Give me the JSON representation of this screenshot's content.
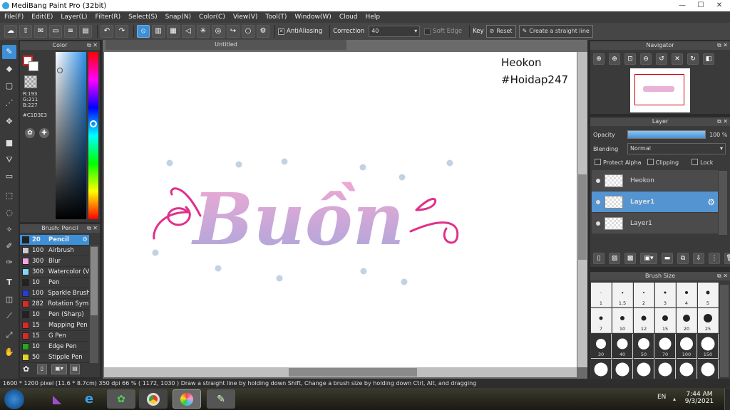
{
  "window": {
    "title": "MediBang Paint Pro (32bit)",
    "minimize": "—",
    "maximize": "☐",
    "close": "✕"
  },
  "menu": [
    "File(F)",
    "Edit(E)",
    "Layer(L)",
    "Filter(R)",
    "Select(S)",
    "Snap(N)",
    "Color(C)",
    "View(V)",
    "Tool(T)",
    "Window(W)",
    "Cloud",
    "Help"
  ],
  "toolbar": {
    "antialiasing": "AntiAliasing",
    "correction_label": "Correction",
    "correction_value": "40",
    "soft_edge": "Soft Edge",
    "key": "Key",
    "reset": "Reset",
    "straight_line": "Create a straight line"
  },
  "color_panel": {
    "title": "Color",
    "r": "R:193",
    "g": "G:211",
    "b": "B:227",
    "hex": "#C1D3E3",
    "accent": "#C1D3E3"
  },
  "canvas": {
    "tab": "Untitled",
    "watermark_line1": "Heokon",
    "watermark_line2": "#Hoidap247",
    "artwork_text": "Buồn"
  },
  "brush_panel": {
    "title": "Brush: Pencil",
    "items": [
      {
        "size": "20",
        "name": "Pencil",
        "color": "#222222"
      },
      {
        "size": "100",
        "name": "Airbrush",
        "color": "#cccccc"
      },
      {
        "size": "300",
        "name": "Blur",
        "color": "#f2a7e6"
      },
      {
        "size": "300",
        "name": "Watercolor (V",
        "color": "#7fd6f5"
      },
      {
        "size": "10",
        "name": "Pen",
        "color": "#222222"
      },
      {
        "size": "100",
        "name": "Sparkle Brush",
        "color": "#2a3bd6"
      },
      {
        "size": "282",
        "name": "Rotation Symi",
        "color": "#d92a2a"
      },
      {
        "size": "10",
        "name": "Pen (Sharp)",
        "color": "#222222"
      },
      {
        "size": "15",
        "name": "Mapping Pen",
        "color": "#d92a2a"
      },
      {
        "size": "15",
        "name": "G Pen",
        "color": "#d92a2a"
      },
      {
        "size": "10",
        "name": "Edge Pen",
        "color": "#22aa22"
      },
      {
        "size": "50",
        "name": "Stipple Pen",
        "color": "#e6d22a"
      }
    ]
  },
  "navigator": {
    "title": "Navigator"
  },
  "layer_panel": {
    "title": "Layer",
    "opacity_label": "Opacity",
    "opacity_value": "100 %",
    "opacity_fraction": 1.0,
    "blending_label": "Blending",
    "blending_value": "Normal",
    "protect_alpha": "Protect Alpha",
    "clipping": "Clipping",
    "lock": "Lock",
    "layers": [
      {
        "name": "Heokon",
        "selected": false
      },
      {
        "name": "Layer1",
        "selected": true
      },
      {
        "name": "Layer1",
        "selected": false
      }
    ]
  },
  "brush_size": {
    "title": "Brush Size",
    "sizes": [
      "1",
      "1.5",
      "2",
      "3",
      "4",
      "5",
      "7",
      "10",
      "12",
      "15",
      "20",
      "25",
      "30",
      "40",
      "50",
      "70",
      "100",
      "150",
      "",
      "",
      "",
      "",
      "",
      ""
    ]
  },
  "status": {
    "text": "1600 * 1200 pixel   (11.6 * 8.7cm)   350 dpi   66 %   ( 1172, 1030 )   Draw a straight line by holding down Shift, Change a brush size by holding down Ctrl, Alt, and dragging"
  },
  "taskbar": {
    "lang": "EN",
    "time": "7:44 AM",
    "date": "9/3/2021"
  }
}
